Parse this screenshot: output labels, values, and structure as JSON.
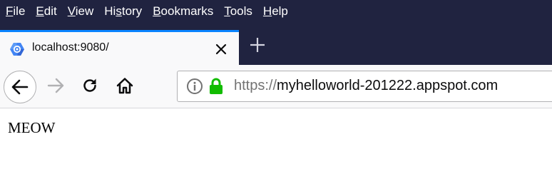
{
  "menu": {
    "items": [
      {
        "key": "F",
        "rest": "ile"
      },
      {
        "key": "E",
        "rest": "dit"
      },
      {
        "key": "V",
        "rest": "iew"
      },
      {
        "pre": "Hi",
        "key": "s",
        "rest": "tory"
      },
      {
        "key": "B",
        "rest": "ookmarks"
      },
      {
        "key": "T",
        "rest": "ools"
      },
      {
        "key": "H",
        "rest": "elp"
      }
    ]
  },
  "tab": {
    "title": "localhost:9080/",
    "favicon": "google-cloud-hexagon-icon"
  },
  "navigation": {
    "back_icon": "back-arrow-icon",
    "forward_icon": "forward-arrow-icon",
    "reload_icon": "reload-icon",
    "home_icon": "home-icon"
  },
  "url_bar": {
    "scheme": "https://",
    "host": "myhelloworld-201222.appspot.com",
    "secure": true
  },
  "page": {
    "body_text": "MEOW"
  },
  "colors": {
    "menu_bar_bg": "#202340",
    "tab_accent": "#0a84ff",
    "lock_green": "#12bc00"
  }
}
